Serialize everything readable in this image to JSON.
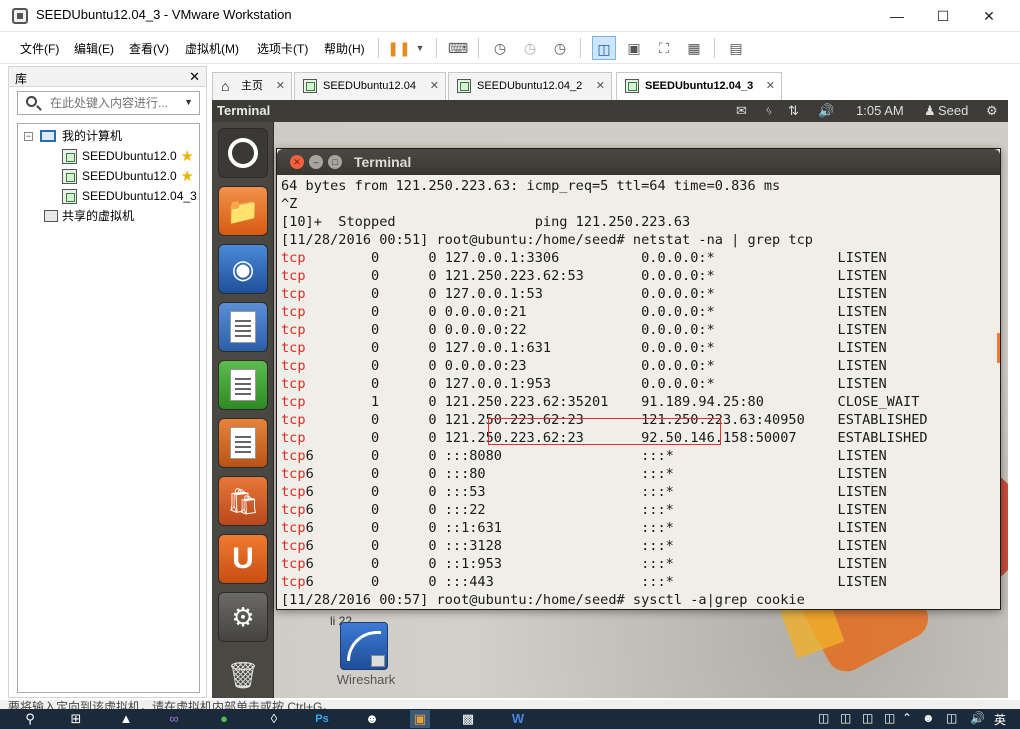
{
  "window": {
    "title": "SEEDUbuntu12.04_3 - VMware Workstation"
  },
  "menu": [
    "文件(F)",
    "编辑(E)",
    "查看(V)",
    "虚拟机(M)",
    "选项卡(T)",
    "帮助(H)"
  ],
  "library": {
    "title": "库",
    "search_placeholder": "在此处键入内容进行...",
    "my_computer": "我的计算机",
    "vms": [
      "SEEDUbuntu12.0",
      "SEEDUbuntu12.0",
      "SEEDUbuntu12.04_3"
    ],
    "shared": "共享的虚拟机"
  },
  "tabs": [
    {
      "label": "主页"
    },
    {
      "label": "SEEDUbuntu12.04"
    },
    {
      "label": "SEEDUbuntu12.04_2"
    },
    {
      "label": "SEEDUbuntu12.04_3"
    }
  ],
  "guest": {
    "panel_title": "Terminal",
    "time": "1:05 AM",
    "user": "Seed",
    "terminal_title": "Terminal",
    "lines": [
      "64 bytes from 121.250.223.63: icmp_req=5 ttl=64 time=0.836 ms",
      "^Z",
      "[10]+  Stopped                 ping 121.250.223.63",
      "[11/28/2016 00:51] root@ubuntu:/home/seed# netstat -na | grep tcp"
    ],
    "netstat": [
      {
        "proto": "tcp",
        "rest": "        0      0 127.0.0.1:3306          0.0.0.0:*               LISTEN"
      },
      {
        "proto": "tcp",
        "rest": "        0      0 121.250.223.62:53       0.0.0.0:*               LISTEN"
      },
      {
        "proto": "tcp",
        "rest": "        0      0 127.0.0.1:53            0.0.0.0:*               LISTEN"
      },
      {
        "proto": "tcp",
        "rest": "        0      0 0.0.0.0:21              0.0.0.0:*               LISTEN"
      },
      {
        "proto": "tcp",
        "rest": "        0      0 0.0.0.0:22              0.0.0.0:*               LISTEN"
      },
      {
        "proto": "tcp",
        "rest": "        0      0 127.0.0.1:631           0.0.0.0:*               LISTEN"
      },
      {
        "proto": "tcp",
        "rest": "        0      0 0.0.0.0:23              0.0.0.0:*               LISTEN"
      },
      {
        "proto": "tcp",
        "rest": "        0      0 127.0.0.1:953           0.0.0.0:*               LISTEN"
      },
      {
        "proto": "tcp",
        "rest": "        1      0 121.250.223.62:35201    91.189.94.25:80         CLOSE_WAIT"
      },
      {
        "proto": "tcp",
        "rest": "        0      0 121.250.223.62:23       121.250.223.63:40950    ESTABLISHED"
      },
      {
        "proto": "tcp",
        "rest": "        0      0 121.250.223.62:23       92.50.146.158:50007     ESTABLISHED"
      },
      {
        "proto": "tcp",
        "suffix": "6",
        "rest": "       0      0 :::8080                 :::*                    LISTEN"
      },
      {
        "proto": "tcp",
        "suffix": "6",
        "rest": "       0      0 :::80                   :::*                    LISTEN"
      },
      {
        "proto": "tcp",
        "suffix": "6",
        "rest": "       0      0 :::53                   :::*                    LISTEN"
      },
      {
        "proto": "tcp",
        "suffix": "6",
        "rest": "       0      0 :::22                   :::*                    LISTEN"
      },
      {
        "proto": "tcp",
        "suffix": "6",
        "rest": "       0      0 ::1:631                 :::*                    LISTEN"
      },
      {
        "proto": "tcp",
        "suffix": "6",
        "rest": "       0      0 :::3128                 :::*                    LISTEN"
      },
      {
        "proto": "tcp",
        "suffix": "6",
        "rest": "       0      0 ::1:953                 :::*                    LISTEN"
      },
      {
        "proto": "tcp",
        "suffix": "6",
        "rest": "       0      0 :::443                  :::*                    LISTEN"
      }
    ],
    "last_line": "[11/28/2016 00:57] root@ubuntu:/home/seed# sysctl -a|grep cookie",
    "desktop_icon": {
      "partial_label": "li        22",
      "label": "Wireshark"
    }
  },
  "status_text": "要将输入定向到该虚拟机，请在虚拟机内部单击或按 Ctrl+G。",
  "taskbar": {
    "tray_lang": "英"
  },
  "colors": {
    "accent": "#d92e22",
    "highlight_box": "#e03030"
  }
}
